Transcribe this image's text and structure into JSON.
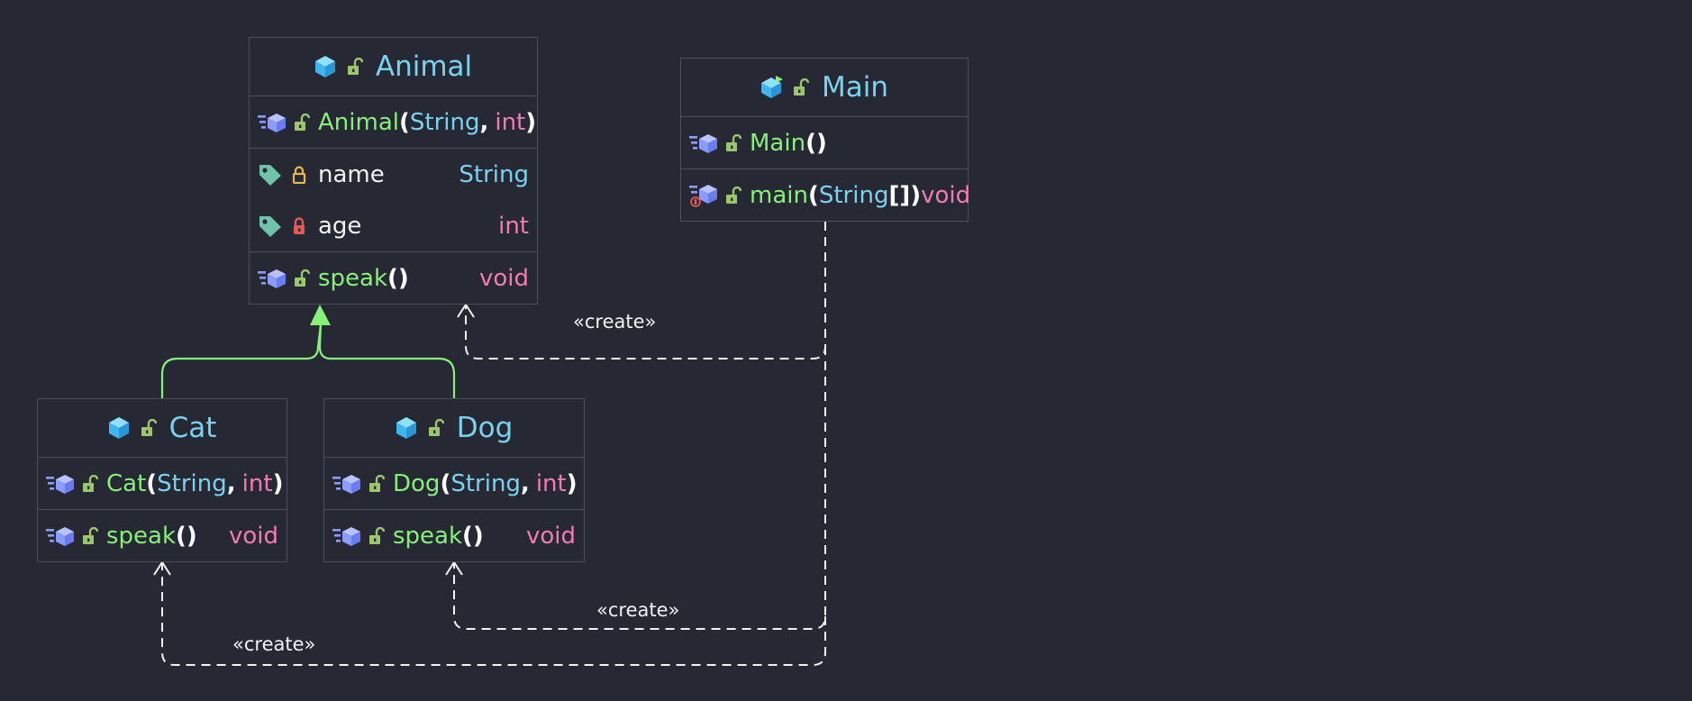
{
  "classes": {
    "animal": {
      "name": "Animal",
      "constructor": {
        "name": "Animal",
        "open": "(",
        "p1": "String",
        "comma": ",",
        "p2": "int",
        "close": ")"
      },
      "fields": [
        {
          "name": "name",
          "type": "String",
          "visibility": "protected"
        },
        {
          "name": "age",
          "type": "int",
          "visibility": "private"
        }
      ],
      "methods": [
        {
          "name": "speak",
          "parens": "()",
          "return": "void"
        }
      ]
    },
    "main": {
      "name": "Main",
      "constructor": {
        "name": "Main",
        "parens": "()"
      },
      "methods": [
        {
          "name": "main",
          "open": "(",
          "p1": "String",
          "array": "[]",
          "close": ")",
          "return": "void",
          "static": true
        }
      ]
    },
    "cat": {
      "name": "Cat",
      "constructor": {
        "name": "Cat",
        "open": "(",
        "p1": "String",
        "comma": ",",
        "p2": "int",
        "close": ")"
      },
      "methods": [
        {
          "name": "speak",
          "parens": "()",
          "return": "void"
        }
      ]
    },
    "dog": {
      "name": "Dog",
      "constructor": {
        "name": "Dog",
        "open": "(",
        "p1": "String",
        "comma": ",",
        "p2": "int",
        "close": ")"
      },
      "methods": [
        {
          "name": "speak",
          "parens": "()",
          "return": "void"
        }
      ]
    }
  },
  "relations": [
    {
      "type": "inheritance",
      "from": "Cat",
      "to": "Animal"
    },
    {
      "type": "inheritance",
      "from": "Dog",
      "to": "Animal"
    },
    {
      "type": "dependency",
      "from": "Main",
      "to": "Animal",
      "label": "«create»"
    },
    {
      "type": "dependency",
      "from": "Main",
      "to": "Dog",
      "label": "«create»"
    },
    {
      "type": "dependency",
      "from": "Main",
      "to": "Cat",
      "label": "«create»"
    }
  ],
  "icons": {
    "class": "class-icon",
    "main_class": "runnable-class-icon",
    "method": "method-icon",
    "static_method": "static-method-icon",
    "field": "field-tag-icon",
    "public": "unlocked-icon",
    "protected": "protected-lock-icon",
    "private": "private-lock-icon"
  },
  "colors": {
    "background": "#262833",
    "border": "#4a4e5c",
    "class_name": "#7ad2ee",
    "method_name": "#88f07a",
    "field_name": "#f2f2f2",
    "type": "#7ad2ee",
    "primitive": "#f27bb3",
    "inheritance_edge": "#88f07a",
    "dependency_edge": "#f2f2f2",
    "public_lock": "#9cc66e",
    "protected_lock": "#e9b84a",
    "private_lock": "#e05a5a"
  }
}
